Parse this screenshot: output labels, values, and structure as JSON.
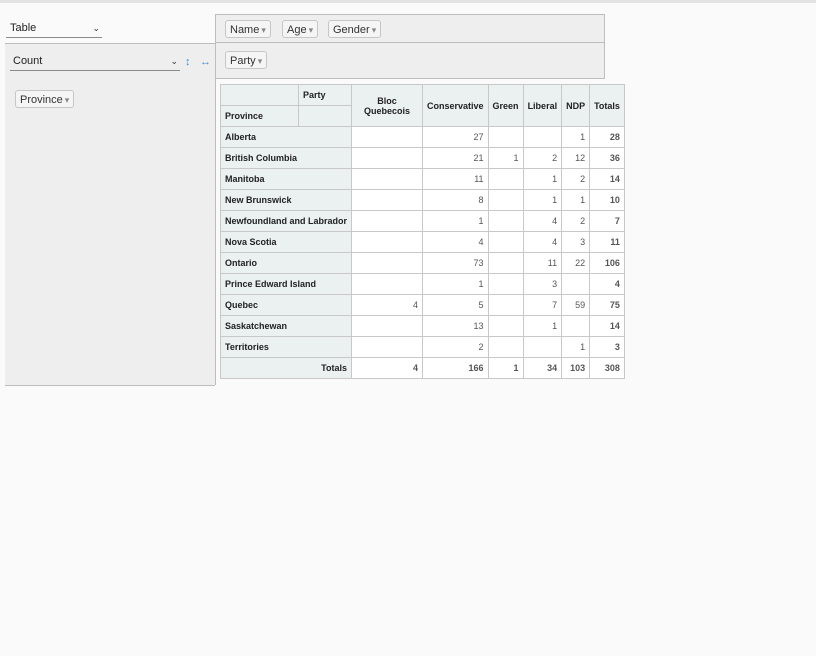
{
  "renderer": {
    "selected": "Table"
  },
  "aggregator": {
    "selected": "Count",
    "sort_icon": "↕",
    "order_icon": "↔"
  },
  "unused_fields": [
    {
      "label": "Name"
    },
    {
      "label": "Age"
    },
    {
      "label": "Gender"
    }
  ],
  "col_fields": [
    {
      "label": "Party"
    }
  ],
  "row_fields": [
    {
      "label": "Province"
    }
  ],
  "dropdown_arrow": "▾",
  "chevron": "⌄",
  "table": {
    "col_axis_label": "Party",
    "row_axis_label": "Province",
    "columns": [
      "Bloc Quebecois",
      "Conservative",
      "Green",
      "Liberal",
      "NDP"
    ],
    "totals_label": "Totals",
    "rows": [
      {
        "province": "Alberta",
        "cells": [
          "",
          "27",
          "",
          "",
          "1"
        ],
        "total": "28"
      },
      {
        "province": "British Columbia",
        "cells": [
          "",
          "21",
          "1",
          "2",
          "12"
        ],
        "total": "36"
      },
      {
        "province": "Manitoba",
        "cells": [
          "",
          "11",
          "",
          "1",
          "2"
        ],
        "total": "14"
      },
      {
        "province": "New Brunswick",
        "cells": [
          "",
          "8",
          "",
          "1",
          "1"
        ],
        "total": "10"
      },
      {
        "province": "Newfoundland and Labrador",
        "cells": [
          "",
          "1",
          "",
          "4",
          "2"
        ],
        "total": "7"
      },
      {
        "province": "Nova Scotia",
        "cells": [
          "",
          "4",
          "",
          "4",
          "3"
        ],
        "total": "11"
      },
      {
        "province": "Ontario",
        "cells": [
          "",
          "73",
          "",
          "11",
          "22"
        ],
        "total": "106"
      },
      {
        "province": "Prince Edward Island",
        "cells": [
          "",
          "1",
          "",
          "3",
          ""
        ],
        "total": "4"
      },
      {
        "province": "Quebec",
        "cells": [
          "4",
          "5",
          "",
          "7",
          "59"
        ],
        "total": "75"
      },
      {
        "province": "Saskatchewan",
        "cells": [
          "",
          "13",
          "",
          "1",
          ""
        ],
        "total": "14"
      },
      {
        "province": "Territories",
        "cells": [
          "",
          "2",
          "",
          "",
          "1"
        ],
        "total": "3"
      }
    ],
    "col_totals": [
      "4",
      "166",
      "1",
      "34",
      "103"
    ],
    "grand_total": "308"
  }
}
